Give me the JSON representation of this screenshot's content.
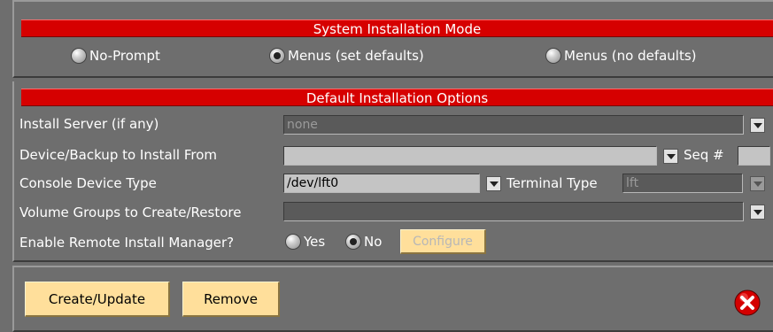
{
  "install_mode": {
    "title": "System Installation Mode",
    "options": [
      {
        "label": "No-Prompt",
        "selected": false
      },
      {
        "label": "Menus (set defaults)",
        "selected": true
      },
      {
        "label": "Menus (no defaults)",
        "selected": false
      }
    ]
  },
  "defaults": {
    "title": "Default Installation Options",
    "install_server": {
      "label": "Install Server (if any)",
      "value": "none"
    },
    "device_backup": {
      "label": "Device/Backup to Install From",
      "value": "",
      "seq_label": "Seq #",
      "seq_value": ""
    },
    "console": {
      "label": "Console Device Type",
      "value": "/dev/lft0",
      "terminal_label": "Terminal Type",
      "terminal_value": "lft"
    },
    "volume_groups": {
      "label": "Volume Groups to Create/Restore",
      "value": ""
    },
    "remote_manager": {
      "label": "Enable Remote Install Manager?",
      "yes_label": "Yes",
      "no_label": "No",
      "selected": "No",
      "configure_label": "Configure"
    }
  },
  "footer": {
    "create_label": "Create/Update",
    "remove_label": "Remove",
    "close_icon": "close-x-icon"
  },
  "colors": {
    "header_red": "#d60000",
    "background": "#6e6e6e",
    "button_bg": "#ffdf9b",
    "close_red": "#d40000"
  }
}
